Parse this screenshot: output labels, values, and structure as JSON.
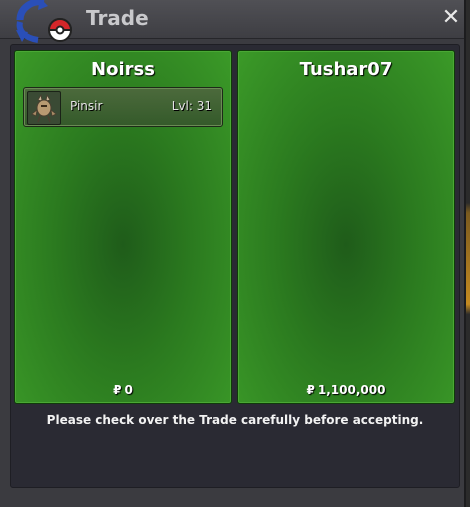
{
  "window": {
    "title": "Trade",
    "close_label": "✕"
  },
  "trade": {
    "left": {
      "name": "Noirss",
      "items": [
        {
          "name": "Pinsir",
          "level": "Lvl: 31"
        }
      ],
      "money": "0"
    },
    "right": {
      "name": "Tushar07",
      "items": [],
      "money": "1,100,000"
    },
    "currency_symbol": "₽",
    "notice": "Please check over the Trade carefully before accepting."
  },
  "colors": {
    "panel_green": "#2b7a1f",
    "window_bg": "#3b3b40",
    "accent_red": "#d4262a",
    "accent_blue": "#2a4fb8"
  },
  "icons": {
    "logo": "pokeball-swap-logo-icon",
    "close": "close-icon",
    "item": "pinsir-sprite-icon"
  }
}
